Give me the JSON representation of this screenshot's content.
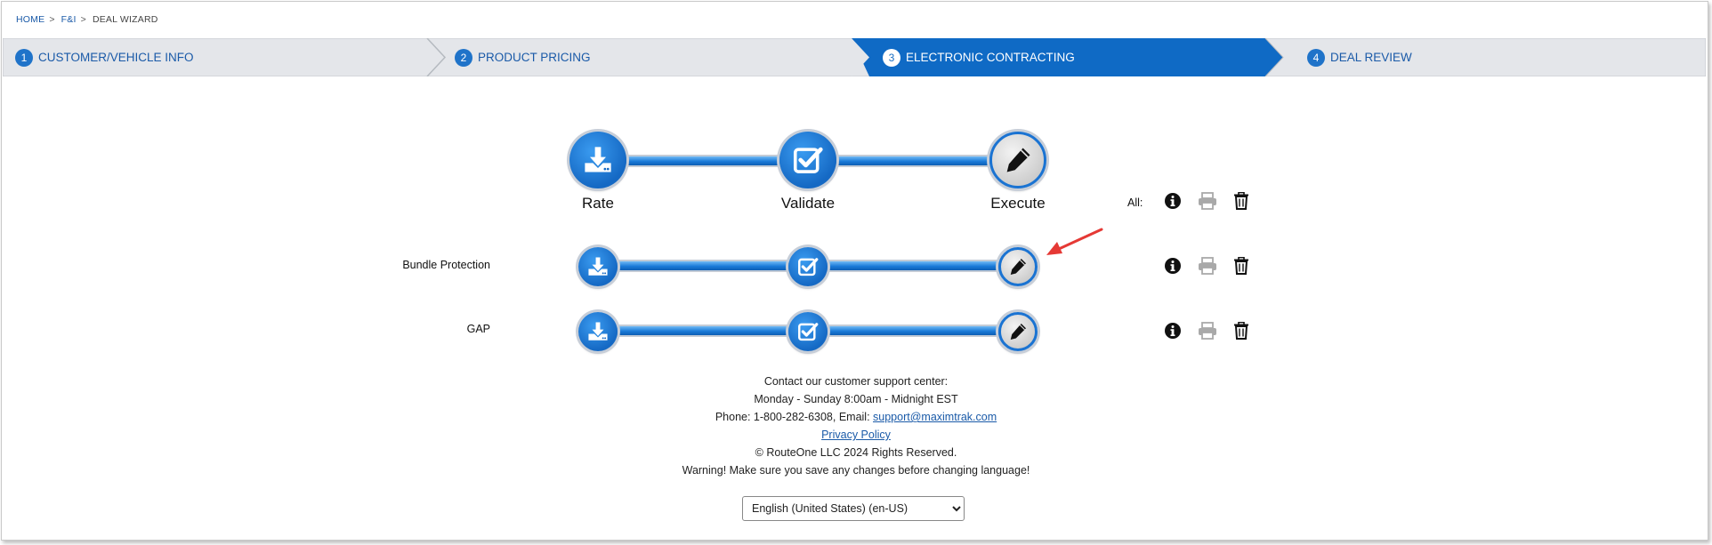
{
  "breadcrumb": {
    "home": "HOME",
    "fi": "F&I",
    "current": "DEAL WIZARD",
    "sep": ">"
  },
  "steps": [
    {
      "num": "1",
      "label": "CUSTOMER/VEHICLE INFO"
    },
    {
      "num": "2",
      "label": "PRODUCT PRICING"
    },
    {
      "num": "3",
      "label": "ELECTRONIC CONTRACTING",
      "active": true
    },
    {
      "num": "4",
      "label": "DEAL REVIEW"
    }
  ],
  "progress": {
    "labels": {
      "rate": "Rate",
      "validate": "Validate",
      "execute": "Execute"
    },
    "all_label": "All:",
    "products": [
      {
        "name": "Bundle Protection"
      },
      {
        "name": "GAP"
      }
    ]
  },
  "icons": {
    "stage_rate": "download-icon",
    "stage_validate": "checkbox-icon",
    "stage_execute": "pencil-icon",
    "actions": [
      "info-icon",
      "print-icon",
      "trash-icon"
    ]
  },
  "footer": {
    "line1": "Contact our customer support center:",
    "line2": "Monday - Sunday 8:00am - Midnight EST",
    "phone_prefix": "Phone: 1-800-282-6308, Email: ",
    "email": "support@maximtrak.com",
    "privacy": "Privacy Policy",
    "copyright": "© RouteOne LLC 2024 Rights Reserved.",
    "warning": "Warning! Make sure you save any changes before changing language!"
  },
  "language": {
    "selected": "English (United States) (en-US)"
  },
  "colors": {
    "primary": "#1a6fc4",
    "step_bg": "#e4e6ea",
    "link": "#1a5aa8",
    "annotation_arrow": "#e53935"
  }
}
